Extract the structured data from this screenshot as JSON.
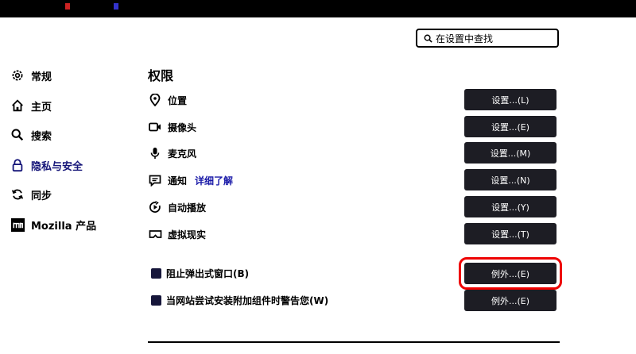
{
  "search": {
    "label": "在设置中查找"
  },
  "sidebar": {
    "items": [
      {
        "label": "常规",
        "icon": "gear-icon"
      },
      {
        "label": "主页",
        "icon": "home-icon"
      },
      {
        "label": "搜索",
        "icon": "search-icon"
      },
      {
        "label": "隐私与安全",
        "icon": "lock-icon",
        "active": true
      },
      {
        "label": "同步",
        "icon": "sync-icon"
      },
      {
        "label": "Mozilla 产品",
        "icon": "mozilla-icon"
      }
    ]
  },
  "permissions": {
    "title": "权限",
    "rows": [
      {
        "label": "位置",
        "icon": "location-icon",
        "button": "设置...(L)"
      },
      {
        "label": "摄像头",
        "icon": "camera-icon",
        "button": "设置...(E)"
      },
      {
        "label": "麦克风",
        "icon": "microphone-icon",
        "button": "设置...(M)"
      },
      {
        "label": "通知",
        "link": "详细了解",
        "icon": "notification-icon",
        "button": "设置...(N)"
      },
      {
        "label": "自动播放",
        "icon": "autoplay-icon",
        "button": "设置...(Y)"
      },
      {
        "label": "虚拟现实",
        "icon": "vr-icon",
        "button": "设置...(T)"
      }
    ],
    "checks": [
      {
        "label": "阻止弹出式窗口(B)",
        "checked": true,
        "button": "例外...(E)"
      },
      {
        "label": "当网站尝试安装附加组件时警告您(W)",
        "checked": true,
        "button": "例外...(E)"
      }
    ]
  },
  "colors": {
    "accent": "#141478",
    "button_bg": "#1d1d24",
    "highlight": "#e00000"
  }
}
